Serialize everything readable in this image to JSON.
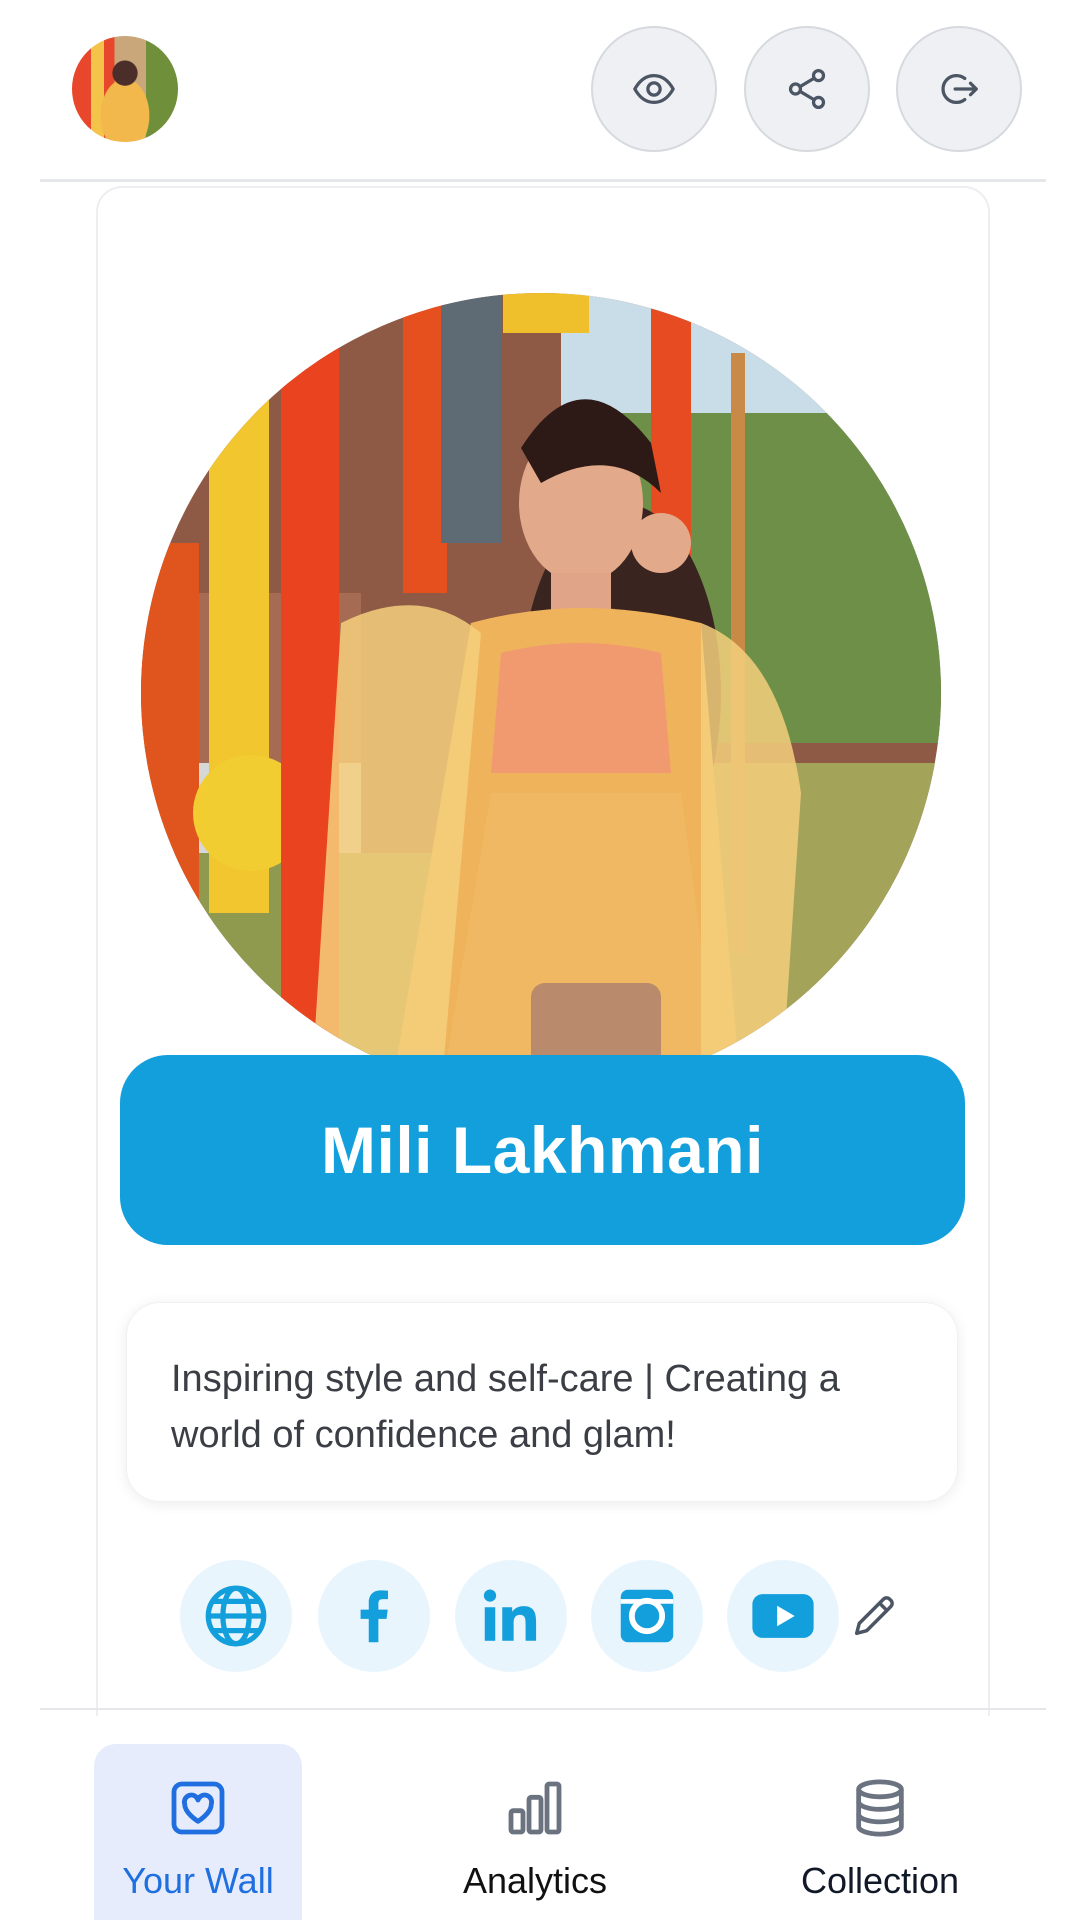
{
  "header": {
    "avatar_alt": "profile avatar",
    "actions": [
      {
        "name": "preview",
        "icon": "eye-icon"
      },
      {
        "name": "share",
        "icon": "share-icon"
      },
      {
        "name": "logout",
        "icon": "logout-icon"
      }
    ]
  },
  "profile": {
    "name": "Mili Lakhmani",
    "bio": "Inspiring style and self-care | Creating a world of confidence and glam!",
    "socials": [
      {
        "name": "website",
        "icon": "globe-icon"
      },
      {
        "name": "facebook",
        "icon": "facebook-icon"
      },
      {
        "name": "linkedin",
        "icon": "linkedin-icon"
      },
      {
        "name": "instagram",
        "icon": "instagram-icon"
      },
      {
        "name": "youtube",
        "icon": "youtube-icon"
      }
    ],
    "edit_icon": "pencil-icon"
  },
  "nav": {
    "items": [
      {
        "label": "Your Wall",
        "icon": "heart-square-icon",
        "active": true
      },
      {
        "label": "Analytics",
        "icon": "bar-chart-icon",
        "active": false
      },
      {
        "label": "Collection",
        "icon": "database-icon",
        "active": false
      }
    ]
  },
  "colors": {
    "accent": "#129fdb",
    "nav_active_bg": "#e6ecfb",
    "nav_active_text": "#1f6fe0",
    "social_bg": "#e9f5fd",
    "social_icon": "#129fdb"
  }
}
